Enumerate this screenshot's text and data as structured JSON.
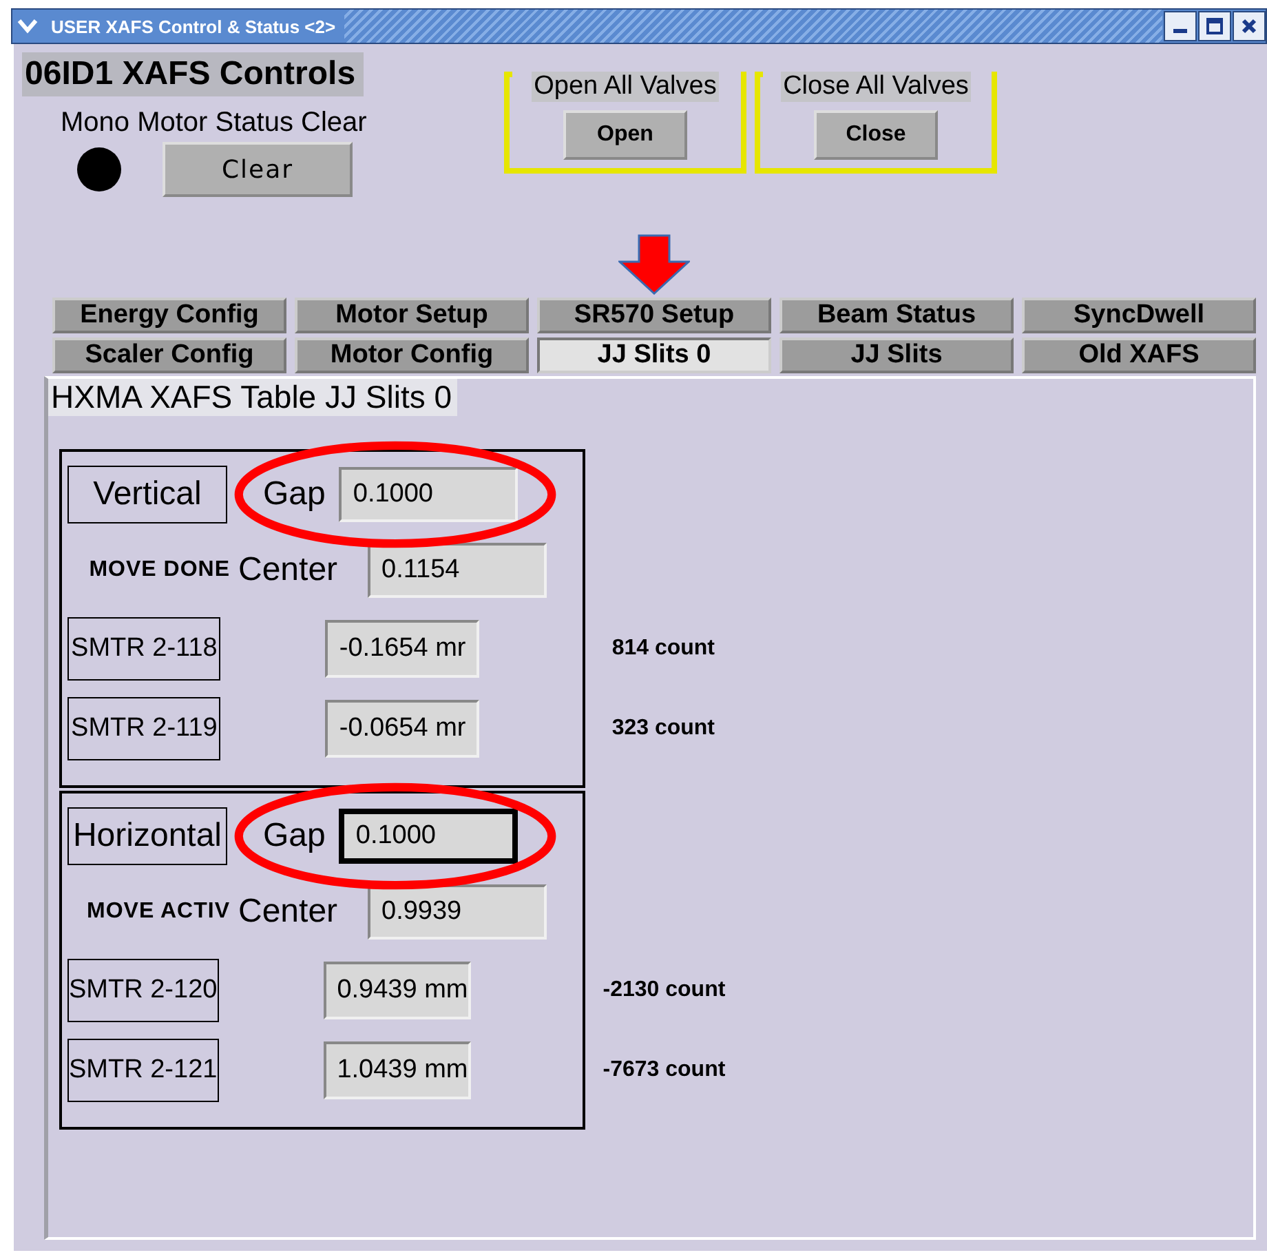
{
  "window": {
    "title": "USER XAFS Control & Status <2>"
  },
  "header": {
    "title": "06ID1 XAFS Controls",
    "status_label": "Mono Motor Status Clear",
    "status_on": true,
    "clear_button": "Clear"
  },
  "valve_groups": [
    {
      "label": "Open All Valves",
      "button": "Open"
    },
    {
      "label": "Close All Valves",
      "button": "Close"
    }
  ],
  "tabs": [
    {
      "label": "Energy Config",
      "selected": false,
      "pointed": false
    },
    {
      "label": "Motor Setup",
      "selected": false,
      "pointed": false
    },
    {
      "label": "SR570 Setup",
      "selected": false,
      "pointed": false
    },
    {
      "label": "Beam Status",
      "selected": false,
      "pointed": false
    },
    {
      "label": "SyncDwell",
      "selected": false,
      "pointed": false
    },
    {
      "label": "Scaler Config",
      "selected": false,
      "pointed": false
    },
    {
      "label": "Motor Config",
      "selected": false,
      "pointed": false
    },
    {
      "label": "JJ Slits 0",
      "selected": true,
      "pointed": true
    },
    {
      "label": "JJ Slits",
      "selected": false,
      "pointed": false
    },
    {
      "label": "Old XAFS",
      "selected": false,
      "pointed": false
    }
  ],
  "panel": {
    "title": "HXMA XAFS Table JJ Slits 0",
    "sections": [
      {
        "name": "Vertical",
        "move_status": "MOVE DONE",
        "gap": {
          "label": "Gap",
          "value": "0.1000",
          "focused": false,
          "circled": true
        },
        "center": {
          "label": "Center",
          "value": "0.1154"
        },
        "motors": [
          {
            "name": "SMTR 2-118",
            "position": "-0.1654 mr",
            "count": "814 count"
          },
          {
            "name": "SMTR 2-119",
            "position": "-0.0654 mr",
            "count": "323 count"
          }
        ]
      },
      {
        "name": "Horizontal",
        "move_status": "MOVE ACTIV",
        "gap": {
          "label": "Gap",
          "value": "0.1000",
          "focused": true,
          "circled": true
        },
        "center": {
          "label": "Center",
          "value": "0.9939"
        },
        "motors": [
          {
            "name": "SMTR 2-120",
            "position": "0.9439 mm",
            "count": "-2130 count"
          },
          {
            "name": "SMTR 2-121",
            "position": "1.0439 mm",
            "count": "-7673 count"
          }
        ]
      }
    ]
  }
}
